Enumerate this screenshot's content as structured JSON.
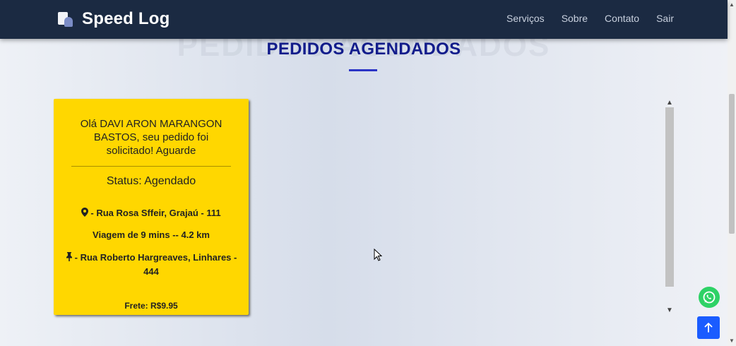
{
  "navbar": {
    "brand": "Speed Log",
    "links": [
      "Serviços",
      "Sobre",
      "Contato",
      "Sair"
    ]
  },
  "section": {
    "title": "PEDIDOS AGENDADOS",
    "title_shadow": "PEDIDOS AGENDADOS"
  },
  "order": {
    "greeting": "Olá DAVI ARON MARANGON BASTOS, seu pedido foi solicitado! Aguarde",
    "status": "Status: Agendado",
    "origin": "- Rua Rosa Sffeir, Grajaú - 111",
    "trip": "Viagem de 9 mins -- 4.2 km",
    "destination": "- Rua Roberto Hargreaves, Linhares - 444",
    "freight": "Frete: R$9.95"
  },
  "colors": {
    "navbar_bg": "#1b2a42",
    "title": "#131d8c",
    "card_bg": "#ffd700",
    "whatsapp": "#2ed266",
    "back_to_top": "#1a5cff"
  },
  "icons": {
    "origin": "map-marker-icon",
    "destination": "pushpin-icon",
    "whatsapp": "whatsapp-icon",
    "back_to_top": "arrow-up-icon"
  }
}
